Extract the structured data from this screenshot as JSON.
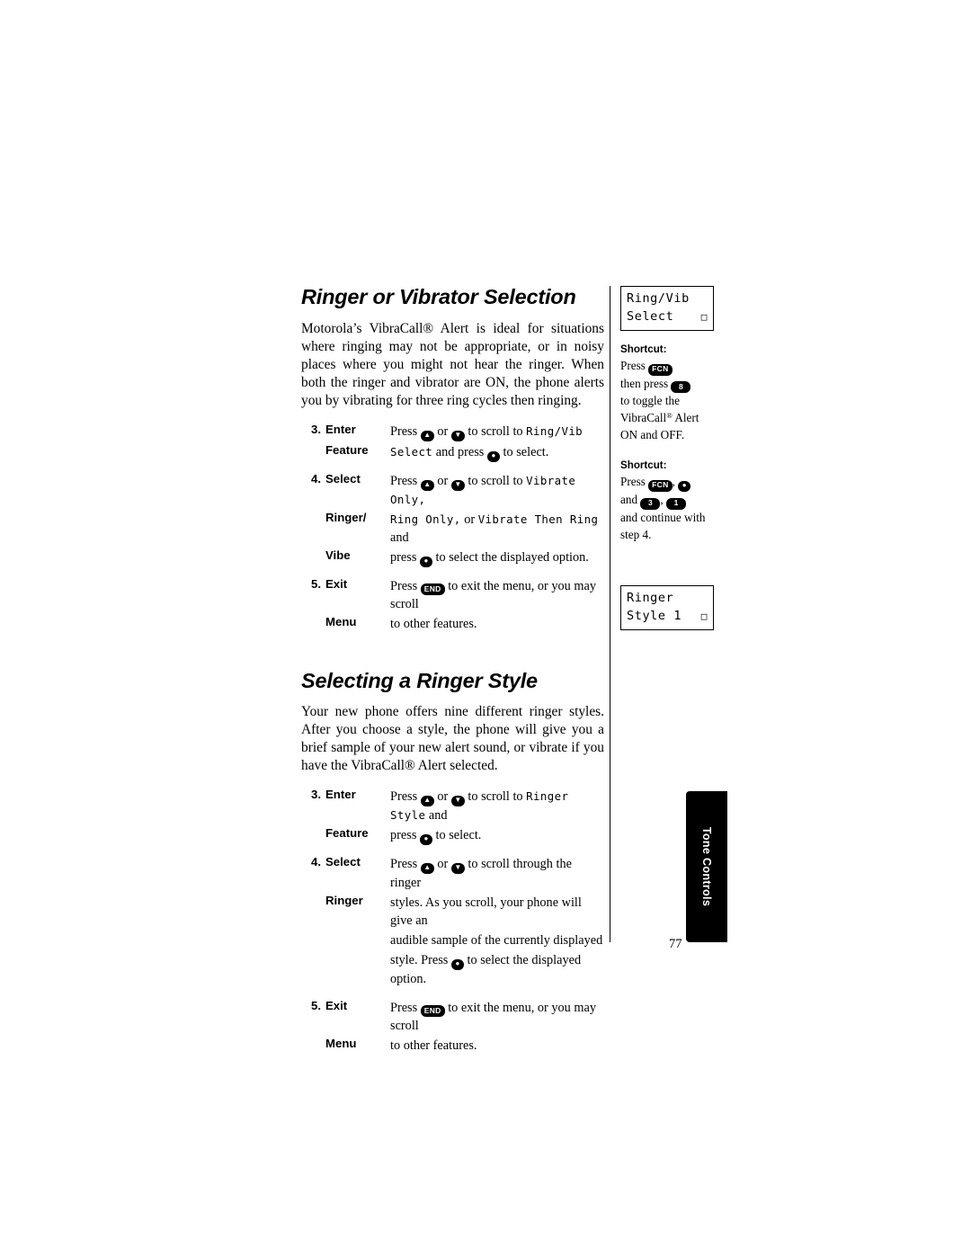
{
  "sections": [
    {
      "title": "Ringer or Vibrator Selection",
      "intro": "Motorola’s VibraCall® Alert is ideal for situations where ringing may not be appropriate, or in noisy places where you might not hear the ringer. When both the ringer and vibrator are ON, the phone alerts you by vibrating for three ring cycles then ringing.",
      "steps": [
        {
          "num": "3.",
          "label_line1": "Enter",
          "label_line2": "Feature",
          "desc_line1_pre": "Press",
          "desc_line1_mid": "or",
          "desc_line1_post": "to scroll to",
          "desc_line1_lcd": "Ring/Vib",
          "desc_line2_lcd": "Select",
          "desc_line2_mid": "and press",
          "desc_line2_post": "to select."
        },
        {
          "num": "4.",
          "label_line1": "Select",
          "label_line2": "Ringer/",
          "label_line3": "Vibe",
          "desc_line1_pre": "Press",
          "desc_line1_mid": "or",
          "desc_line1_post": "to scroll to",
          "desc_line1_lcd": "Vibrate Only,",
          "desc_line2_lcd_a": "Ring Only,",
          "desc_line2_or": "or",
          "desc_line2_lcd_b": "Vibrate Then Ring",
          "desc_line2_end": "and",
          "desc_line3_pre": "press",
          "desc_line3_post": "to select the displayed option."
        },
        {
          "num": "5.",
          "label_line1": "Exit",
          "label_line2": "Menu",
          "desc_line1_pre": "Press",
          "desc_line1_post": "to exit the menu, or you may scroll",
          "desc_line2": "to other features."
        }
      ],
      "lcd": {
        "line1": "Ring/Vib",
        "line2": "Select",
        "menu_glyph": "□"
      }
    },
    {
      "title": "Selecting a Ringer Style",
      "intro": "Your new phone offers nine different ringer styles. After you choose a style, the phone will give you a brief sample of your new alert sound, or vibrate if you have the VibraCall® Alert selected.",
      "steps": [
        {
          "num": "3.",
          "label_line1": "Enter",
          "label_line2": "Feature",
          "desc_line1_pre": "Press",
          "desc_line1_mid": "or",
          "desc_line1_post": "to scroll to",
          "desc_line1_lcd": "Ringer Style",
          "desc_line1_end": "and",
          "desc_line2_pre": "press",
          "desc_line2_post": "to select."
        },
        {
          "num": "4.",
          "label_line1": "Select",
          "label_line2": "Ringer",
          "desc_line1_pre": "Press",
          "desc_line1_mid": "or",
          "desc_line1_post": "to scroll through the ringer",
          "desc_line2": "styles. As you scroll, your phone will give an",
          "desc_line3": "audible sample of the currently displayed",
          "desc_line4_pre": "style. Press",
          "desc_line4_post": "to select the displayed option."
        },
        {
          "num": "5.",
          "label_line1": "Exit",
          "label_line2": "Menu",
          "desc_line1_pre": "Press",
          "desc_line1_post": "to exit the menu, or you may scroll",
          "desc_line2": "to other features."
        }
      ],
      "lcd": {
        "line1": "Ringer",
        "line2": "Style 1",
        "menu_glyph": "□"
      }
    }
  ],
  "shortcuts": [
    {
      "title": "Shortcut:",
      "line1_pre": "Press",
      "line1_key": "FCN",
      "line2_pre": "then press",
      "line2_key": "8",
      "line3": "to toggle the",
      "line4": "VibraCall® Alert",
      "line5": "ON and OFF."
    },
    {
      "title": "Shortcut:",
      "line1_pre": "Press",
      "line1_key": "FCN",
      "line2_pre": "and",
      "line2_key_a": "3",
      "line2_key_b": "1",
      "line3": "and continue with",
      "line4": "step 4."
    }
  ],
  "keys": {
    "nav_up": "▲",
    "nav_down": "▼",
    "select": "●",
    "end": "END",
    "fcn": "FCN",
    "num8": "8",
    "num3": "3",
    "num1": "1"
  },
  "thumb_tab": {
    "label": "Tone Controls"
  },
  "page_number": "77"
}
